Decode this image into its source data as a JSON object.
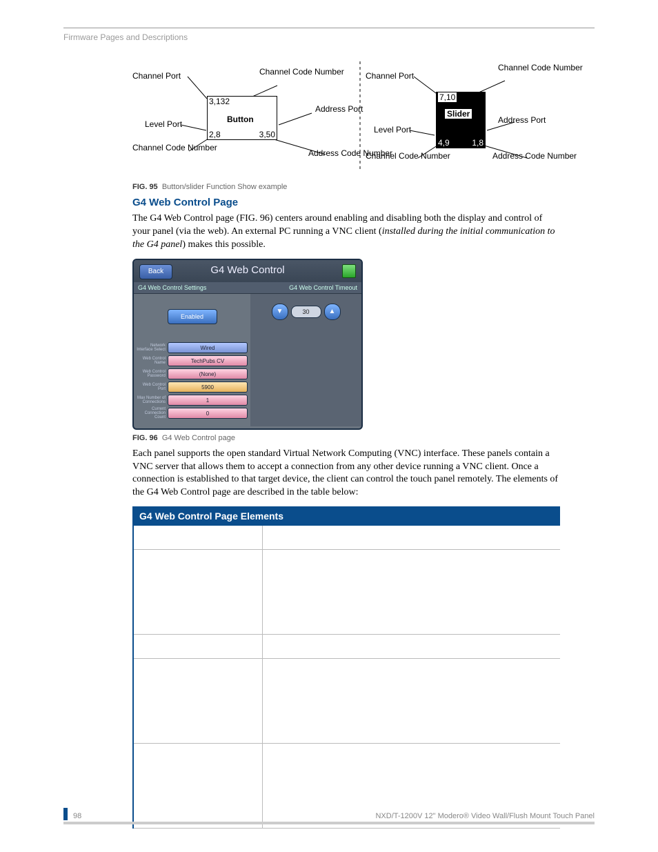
{
  "header": {
    "breadcrumb": "Firmware Pages and Descriptions"
  },
  "diagram": {
    "labels": {
      "channel_port": "Channel Port",
      "channel_code_number": "Channel Code Number",
      "address_port": "Address Port",
      "level_port": "Level Port",
      "address_code_number": "Address Code Number",
      "button": "Button",
      "slider": "Slider"
    },
    "button_box": {
      "topleft": "3,132",
      "bottomleft": "2,8",
      "bottomright": "3,50"
    },
    "slider_box": {
      "topleft": "7,10",
      "bottomleft": "4,9",
      "bottomright": "1,8"
    }
  },
  "fig95": {
    "label": "FIG. 95",
    "caption": "Button/slider Function Show example"
  },
  "section_title": "G4 Web Control Page",
  "para1_pre": "The G4 Web Control page (FIG. 96) centers around enabling and disabling both the display and control of your panel (via the web). An external PC running a VNC client (",
  "para1_ital": "installed during the initial communication to the G4 panel",
  "para1_post": ") makes this possible.",
  "g4panel": {
    "back": "Back",
    "title": "G4 Web Control",
    "sub_left": "G4 Web Control Settings",
    "sub_right": "G4 Web Control Timeout",
    "enabled": "Enabled",
    "timeout_value": "30",
    "rows": [
      {
        "label": "Network Interface Select",
        "value": "Wired",
        "cls": "blue"
      },
      {
        "label": "Web Control Name",
        "value": "TechPubs CV",
        "cls": "pink"
      },
      {
        "label": "Web Control Password",
        "value": "(None)",
        "cls": "pink"
      },
      {
        "label": "Web Control Port",
        "value": "5900",
        "cls": "or"
      },
      {
        "label": "Max Number of Connections",
        "value": "1",
        "cls": "pink"
      },
      {
        "label": "Current Connection Count",
        "value": "0",
        "cls": "pink"
      }
    ]
  },
  "fig96": {
    "label": "FIG. 96",
    "caption": "G4 Web Control page"
  },
  "para2": "Each panel supports the open standard Virtual Network Computing (VNC) interface. These panels contain a VNC server that allows them to accept a connection from any other device running a VNC client. Once a connection is established to that target device, the client can control the touch panel remotely. The elements of the G4 Web Control page are described in the table below:",
  "table": {
    "title": "G4 Web Control Page Elements"
  },
  "footer": {
    "page": "98",
    "doc": "NXD/T-1200V 12\" Modero® Video Wall/Flush Mount Touch Panel"
  }
}
